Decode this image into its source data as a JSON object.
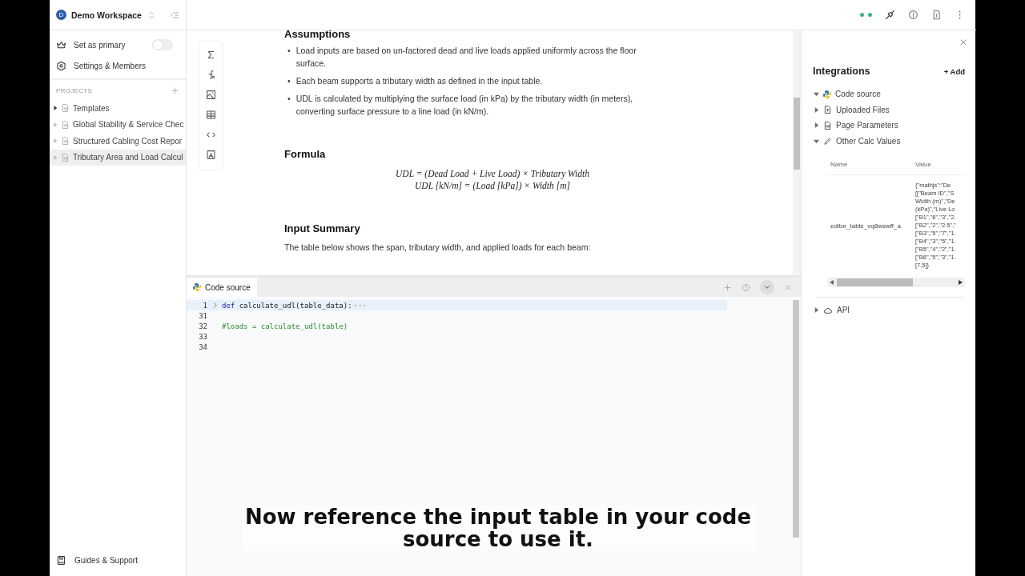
{
  "workspace": {
    "avatar": "D",
    "name": "Demo Workspace"
  },
  "sidebar": {
    "items": [
      {
        "kind": "toggle",
        "label": "Set as primary",
        "on": false
      },
      {
        "kind": "link",
        "label": "Settings & Members"
      }
    ],
    "projects_heading": "PROJECTS",
    "projects": [
      {
        "label": "Templates",
        "selected": false
      },
      {
        "label": "Global Stability & Service Chec",
        "selected": false
      },
      {
        "label": "Structured Cabling Cost Repor",
        "selected": false
      },
      {
        "label": "Tributary Area and Load Calcul",
        "selected": true
      }
    ],
    "footer": "Guides & Support"
  },
  "document": {
    "sections": [
      {
        "kind": "heading",
        "text": "Assumptions"
      },
      {
        "kind": "bullets",
        "marker": "•",
        "items": [
          "Load inputs are based on un-factored dead and live loads applied uniformly across the floor surface.",
          "Each beam supports a tributary width as defined in the input table.",
          "UDL is calculated by multiplying the surface load (in kPa) by the tributary width (in meters), converting surface pressure to a line load (in kN/m)."
        ]
      },
      {
        "kind": "heading",
        "text": "Formula"
      },
      {
        "kind": "formula",
        "lines": [
          "UDL = (Dead Load + Live Load) × Tributary Width",
          "UDL [kN/m] = (Load [kPa]) × Width [m]"
        ]
      },
      {
        "kind": "heading",
        "text": "Input Summary"
      },
      {
        "kind": "paragraph",
        "text": "The table below shows the span, tributary width, and applied loads for each beam:"
      }
    ]
  },
  "code_panel": {
    "tab": "Code source",
    "lines": [
      {
        "number": "1",
        "kind": "def",
        "text": "def calculate_udl(table_data):",
        "fold": "···"
      },
      {
        "number": "31",
        "kind": "blank"
      },
      {
        "number": "32",
        "kind": "comment",
        "text": "#loads = calculate_udl(table)"
      },
      {
        "number": "33",
        "kind": "blank"
      },
      {
        "number": "34",
        "kind": "blank"
      }
    ]
  },
  "integrations": {
    "title": "Integrations",
    "add": "+ Add",
    "tree": [
      {
        "kind": "python",
        "label": "Code source",
        "expanded": true
      },
      {
        "kind": "upload",
        "label": "Uploaded Files",
        "expanded": false
      },
      {
        "kind": "page",
        "label": "Page Parameters",
        "expanded": false
      },
      {
        "kind": "pencil",
        "label": "Other Calc Values",
        "expanded": true,
        "table": {
          "columns": [
            "Name",
            "Value"
          ],
          "rows": [
            {
              "name": "editor_table_vq8wswff_a",
              "value_lines": [
                "{\"mathjs\":\"De",
                "[[\"Beam ID\",\"S",
                "Width (m)\",\"De",
                "(kPa)\",\"Live Lo",
                "[\"B1\",\"6\",\"3\",\"2.",
                "[\"B2\",\"2\",\"2.5\",\"",
                "[\"B3\",\"5\",\"7\",\"1.",
                "[\"B4\",\"3\",\"5\",\"1.",
                "[\"B5\",\"4\",\"2\",\"1.",
                "[\"B6\",\"5\",\"3\",\"1.",
                "[7,5]}"
              ]
            }
          ]
        }
      },
      {
        "kind": "cloud",
        "label": "API",
        "expanded": false
      }
    ]
  },
  "caption": "Now reference the input table in your code source to use it."
}
